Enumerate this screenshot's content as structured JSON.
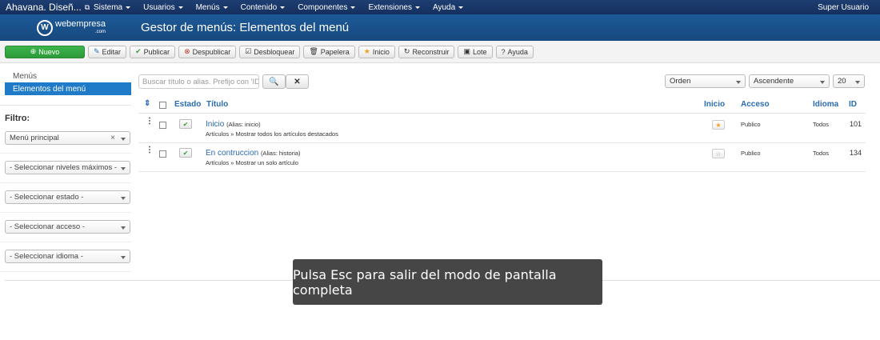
{
  "navbar": {
    "site_title": "Ahavana. Diseñ...",
    "items": [
      {
        "label": "Sistema"
      },
      {
        "label": "Usuarios"
      },
      {
        "label": "Menús"
      },
      {
        "label": "Contenido"
      },
      {
        "label": "Componentes"
      },
      {
        "label": "Extensiones"
      },
      {
        "label": "Ayuda"
      }
    ],
    "user": "Super Usuario"
  },
  "header": {
    "logo_text": "webempresa",
    "logo_sub": ".com",
    "title": "Gestor de menús: Elementos del menú"
  },
  "toolbar": {
    "new": "Nuevo",
    "edit": "Editar",
    "publish": "Publicar",
    "unpublish": "Despublicar",
    "checkin": "Desbloquear",
    "trash": "Papelera",
    "home": "Inicio",
    "rebuild": "Reconstruir",
    "batch": "Lote",
    "help": "Ayuda"
  },
  "sidebar": {
    "links": [
      "Menús",
      "Elementos del menú"
    ],
    "filter_title": "Filtro:",
    "menu_select": "Menú principal",
    "levels": "- Seleccionar niveles máximos -",
    "state": "- Seleccionar estado -",
    "access": "- Seleccionar acceso -",
    "language": "- Seleccionar idioma -"
  },
  "search": {
    "placeholder": "Buscar título o alias. Prefijo con 'ID:'",
    "order": "Orden",
    "direction": "Ascendente",
    "limit": "20"
  },
  "table": {
    "headers": {
      "state": "Estado",
      "title": "Título",
      "home": "Inicio",
      "access": "Acceso",
      "language": "Idioma",
      "id": "ID"
    },
    "rows": [
      {
        "title": "Inicio",
        "alias": "(Alias: inicio)",
        "sub": "Artículos » Mostrar todos los artículos destacados",
        "access": "Publico",
        "language": "Todos",
        "id": "101",
        "home": true
      },
      {
        "title": "En contruccion",
        "alias": "(Alias: historia)",
        "sub": "Artículos » Mostrar un solo artículo",
        "access": "Publico",
        "language": "Todos",
        "id": "134",
        "home": false
      }
    ]
  },
  "toast": "Pulsa Esc para salir del modo de pantalla completa"
}
